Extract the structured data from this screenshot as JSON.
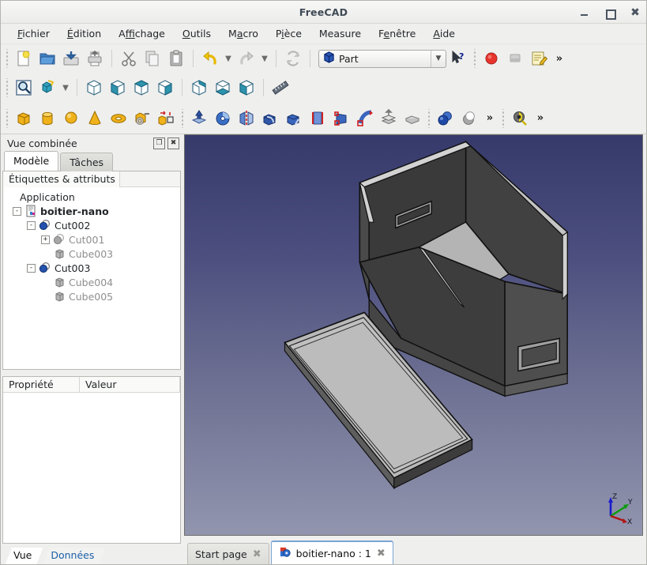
{
  "window": {
    "title": "FreeCAD",
    "controls": {
      "minimize": "minimize-button",
      "maximize": "maximize-button",
      "close": "close-button"
    }
  },
  "menubar": {
    "items": [
      {
        "label": "Fichier",
        "mnemonic": "F"
      },
      {
        "label": "Édition",
        "mnemonic": "É"
      },
      {
        "label": "Affichage",
        "mnemonic": "ff"
      },
      {
        "label": "Outils",
        "mnemonic": "O"
      },
      {
        "label": "Macro",
        "mnemonic": "M"
      },
      {
        "label": "Pièce",
        "mnemonic": "P"
      },
      {
        "label": "Measure",
        "mnemonic": ""
      },
      {
        "label": "Fenêtre",
        "mnemonic": "F"
      },
      {
        "label": "Aide",
        "mnemonic": "A"
      }
    ]
  },
  "toolbars": {
    "file": {
      "buttons": [
        {
          "name": "new-document-icon",
          "title": "Nouveau"
        },
        {
          "name": "open-document-icon",
          "title": "Ouvrir"
        },
        {
          "name": "save-document-icon",
          "title": "Enregistrer"
        },
        {
          "name": "print-document-icon",
          "title": "Imprimer"
        },
        {
          "name": "cut-icon",
          "title": "Couper"
        },
        {
          "name": "copy-icon",
          "title": "Copier"
        },
        {
          "name": "paste-icon",
          "title": "Coller"
        },
        {
          "name": "undo-icon",
          "title": "Annuler"
        },
        {
          "name": "undo-dropdown-icon",
          "title": "Historique annuler"
        },
        {
          "name": "redo-icon",
          "title": "Rétablir"
        },
        {
          "name": "redo-dropdown-icon",
          "title": "Historique rétablir"
        },
        {
          "name": "refresh-icon",
          "title": "Rafraîchir"
        }
      ],
      "workbench": {
        "label": "Part",
        "icon": "part-workbench-icon"
      },
      "whats_this": {
        "name": "whats-this-icon",
        "title": "Qu'est-ce que c'est ?"
      },
      "macro_record": {
        "name": "macro-record-icon",
        "title": "Enregistrer une macro"
      },
      "macro_stop": {
        "name": "macro-stop-icon",
        "title": "Arrêter l'enregistrement"
      },
      "macro_edit": {
        "name": "macro-edit-icon",
        "title": "Macros"
      },
      "overflow": "»"
    },
    "view": {
      "buttons": [
        {
          "name": "fit-all-icon",
          "title": "Tout afficher"
        },
        {
          "name": "draw-style-icon",
          "title": "Style de rendu"
        },
        {
          "name": "draw-style-dropdown-icon",
          "title": "Choisir le style"
        },
        {
          "name": "isometric-view-icon",
          "title": "Vue axonométrique"
        },
        {
          "name": "front-view-icon",
          "title": "Vue de face"
        },
        {
          "name": "top-view-icon",
          "title": "Vue de dessus"
        },
        {
          "name": "right-view-icon",
          "title": "Vue de droite"
        },
        {
          "name": "rear-view-icon",
          "title": "Vue arrière"
        },
        {
          "name": "bottom-view-icon",
          "title": "Vue de dessous"
        },
        {
          "name": "left-view-icon",
          "title": "Vue de gauche"
        },
        {
          "name": "measure-ruler-icon",
          "title": "Mesurer"
        }
      ]
    },
    "part": {
      "buttons": [
        {
          "name": "box-primitive-icon",
          "title": "Cube"
        },
        {
          "name": "cylinder-primitive-icon",
          "title": "Cylindre"
        },
        {
          "name": "sphere-primitive-icon",
          "title": "Sphère"
        },
        {
          "name": "cone-primitive-icon",
          "title": "Cône"
        },
        {
          "name": "torus-primitive-icon",
          "title": "Tore"
        },
        {
          "name": "primitives-icon",
          "title": "Créer des primitives"
        },
        {
          "name": "shape-builder-icon",
          "title": "Constructeur de formes"
        },
        {
          "name": "extrude-icon",
          "title": "Extruder"
        },
        {
          "name": "revolve-icon",
          "title": "Révolution"
        },
        {
          "name": "mirror-icon",
          "title": "Symétrie"
        },
        {
          "name": "fillet-icon",
          "title": "Congé"
        },
        {
          "name": "chamfer-icon",
          "title": "Chanfrein"
        },
        {
          "name": "ruled-surface-icon",
          "title": "Surface réglée"
        },
        {
          "name": "loft-icon",
          "title": "Lissage"
        },
        {
          "name": "sweep-icon",
          "title": "Balayage"
        },
        {
          "name": "section-icon",
          "title": "Section"
        },
        {
          "name": "cross-sections-icon",
          "title": "Sections"
        },
        {
          "name": "boolean-icon",
          "title": "Opération booléenne"
        },
        {
          "name": "cut-boolean-icon",
          "title": "Soustraction"
        }
      ],
      "overflow": "»",
      "inspect": {
        "name": "measure-inspect-icon",
        "title": "Inspection"
      },
      "overflow2": "»"
    }
  },
  "dock": {
    "title": "Vue combinée",
    "float_icon": "float-panel-icon",
    "close_icon": "close-panel-icon",
    "tabs": [
      {
        "label": "Modèle",
        "active": true
      },
      {
        "label": "Tâches",
        "active": false
      }
    ],
    "tree": {
      "column_header": "Étiquettes & attributs",
      "root": "Application",
      "items": [
        {
          "label": "boitier-nano",
          "indent": 1,
          "toggle": "-",
          "icon": "document-icon",
          "bold": true,
          "dim": false
        },
        {
          "label": "Cut002",
          "indent": 2,
          "toggle": "-",
          "icon": "cut-feature-icon",
          "bold": false,
          "dim": false
        },
        {
          "label": "Cut001",
          "indent": 3,
          "toggle": "+",
          "icon": "cut-feature-icon-grey",
          "bold": false,
          "dim": true
        },
        {
          "label": "Cube003",
          "indent": 3,
          "toggle": "",
          "icon": "box-feature-icon",
          "bold": false,
          "dim": true
        },
        {
          "label": "Cut003",
          "indent": 2,
          "toggle": "-",
          "icon": "cut-feature-icon",
          "bold": false,
          "dim": false
        },
        {
          "label": "Cube004",
          "indent": 3,
          "toggle": "",
          "icon": "box-feature-icon",
          "bold": false,
          "dim": true
        },
        {
          "label": "Cube005",
          "indent": 3,
          "toggle": "",
          "icon": "box-feature-icon",
          "bold": false,
          "dim": true
        }
      ]
    },
    "properties": {
      "columns": [
        "Propriété",
        "Valeur"
      ],
      "rows": []
    },
    "view_tabs": [
      {
        "label": "Vue",
        "active": true
      },
      {
        "label": "Données",
        "active": false
      }
    ]
  },
  "view3d": {
    "background_top": "#363a6b",
    "background_bottom": "#9295ae",
    "model_name": "boitier-nano",
    "axis_indicator": {
      "z": {
        "label": "Z",
        "color": "#1b1bcc"
      },
      "y": {
        "label": "Y",
        "color": "#0a9c0a"
      },
      "x": {
        "label": "X",
        "color": "#b01414"
      }
    }
  },
  "doc_tabs": [
    {
      "label": "Start page",
      "active": false,
      "icon": "",
      "close_icon": "close-tab-icon"
    },
    {
      "label": "boitier-nano : 1",
      "active": true,
      "icon": "freecad-document-icon",
      "close_icon": "close-tab-icon"
    }
  ]
}
